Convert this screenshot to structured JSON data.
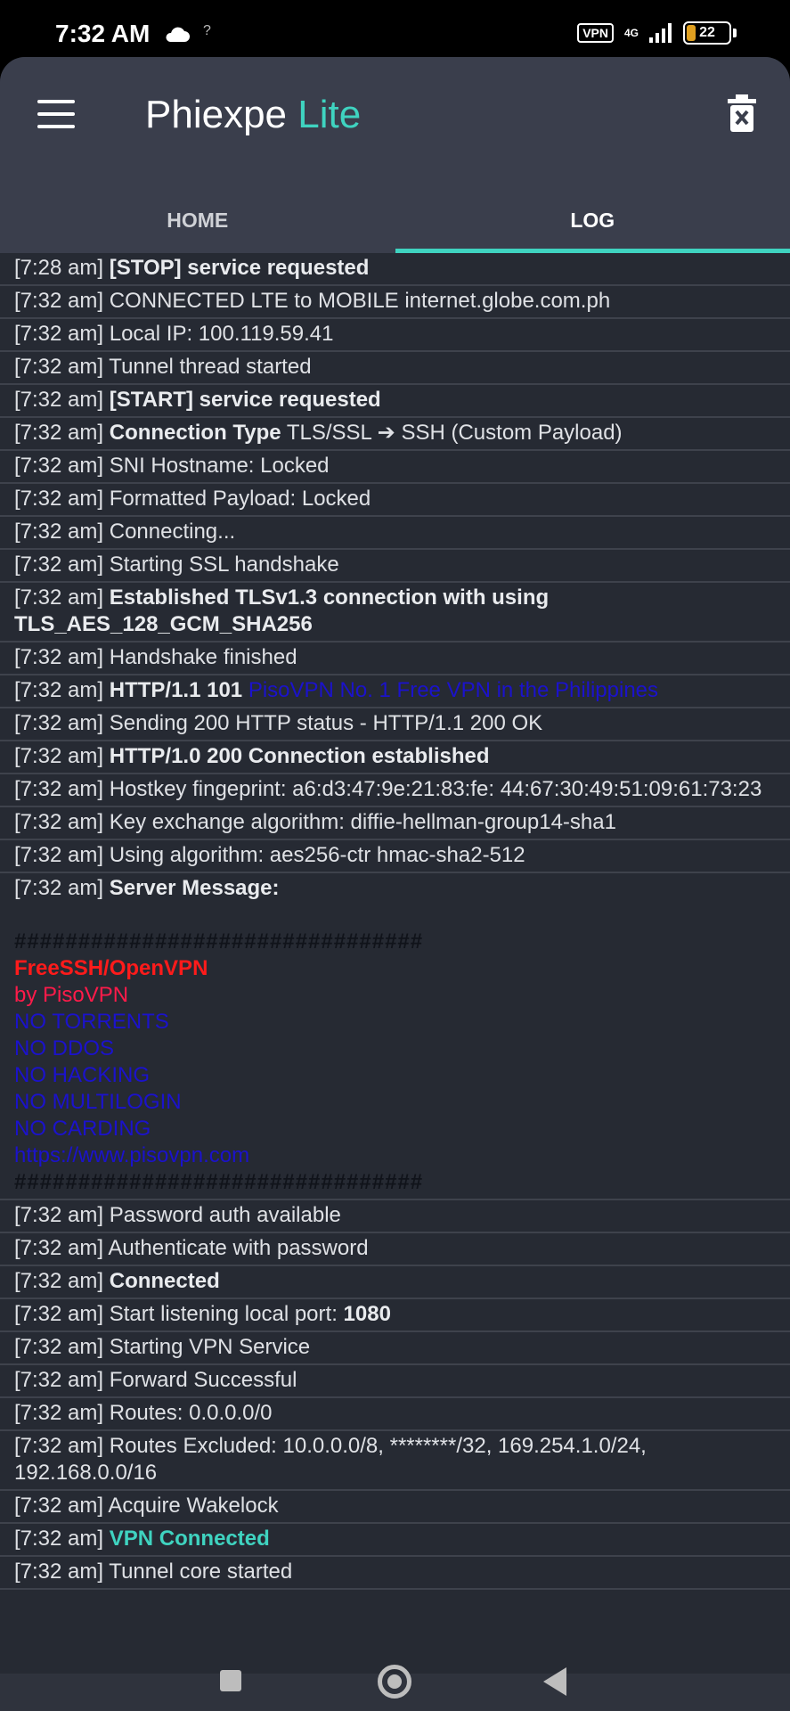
{
  "status_bar": {
    "time": "7:32 AM",
    "network_hint": "?",
    "vpn_label": "VPN",
    "network_type": "4G",
    "battery": "22"
  },
  "app": {
    "title_main": "Phiexpe",
    "title_accent": "Lite",
    "accent_color": "#3fd3c0",
    "tabs": [
      {
        "label": "HOME",
        "active": false
      },
      {
        "label": "LOG",
        "active": true
      }
    ]
  },
  "log": [
    {
      "time": "[7:28 am]",
      "bold": "[STOP] service requested",
      "text": ""
    },
    {
      "time": "[7:32 am]",
      "text": "CONNECTED LTE to MOBILE internet.globe.com.ph"
    },
    {
      "time": "[7:32 am]",
      "text": "Local IP: 100.119.59.41"
    },
    {
      "time": "[7:32 am]",
      "text": "Tunnel thread started"
    },
    {
      "time": "[7:32 am]",
      "bold": "[START] service requested",
      "text": ""
    },
    {
      "time": "[7:32 am]",
      "bold": "Connection Type",
      "text": "TLS/SSL ➔ SSH (Custom Payload)"
    },
    {
      "time": "[7:32 am]",
      "text": "SNI Hostname: Locked"
    },
    {
      "time": "[7:32 am]",
      "text": "Formatted Payload: Locked"
    },
    {
      "time": "[7:32 am]",
      "text": "Connecting..."
    },
    {
      "time": "[7:32 am]",
      "text": "Starting SSL handshake"
    },
    {
      "time": "[7:32 am]",
      "bold": "Established TLSv1.3 connection with using TLS_AES_128_GCM_SHA256",
      "text": ""
    },
    {
      "time": "[7:32 am]",
      "text": "Handshake finished"
    },
    {
      "time": "[7:32 am]",
      "bold": "HTTP/1.1 101",
      "blue": "PisoVPN No. 1 Free VPN in the Philippines",
      "text": ""
    },
    {
      "time": "[7:32 am]",
      "text": "Sending 200 HTTP status - HTTP/1.1 200 OK"
    },
    {
      "time": "[7:32 am]",
      "bold": "HTTP/1.0 200 Connection established",
      "text": ""
    },
    {
      "time": "[7:32 am]",
      "text": "Hostkey fingeprint: a6:d3:47:9e:21:83:fe: 44:67:30:49:51:09:61:73:23"
    },
    {
      "time": "[7:32 am]",
      "text": "Key exchange algorithm: diffie-hellman-group14-sha1"
    },
    {
      "time": "[7:32 am]",
      "text": "Using algorithm: aes256-ctr hmac-sha2-512"
    }
  ],
  "server_message": {
    "time": "[7:32 am]",
    "label": "Server Message:",
    "hashes": "################################",
    "line_red": "FreeSSH/OpenVPN",
    "line_pink": "by PisoVPN",
    "blue_lines": [
      "NO TORRENTS",
      "NO DDOS",
      "NO HACKING",
      "NO MULTILOGIN",
      "NO CARDING",
      "https://www.pisovpn.com"
    ]
  },
  "log2": [
    {
      "time": "[7:32 am]",
      "text": "Password auth available"
    },
    {
      "time": "[7:32 am]",
      "text": "Authenticate with password"
    },
    {
      "time": "[7:32 am]",
      "bold": "Connected",
      "text": ""
    },
    {
      "time": "[7:32 am]",
      "text": "Start listening local port:",
      "bold_after": "1080"
    },
    {
      "time": "[7:32 am]",
      "text": "Starting VPN Service"
    },
    {
      "time": "[7:32 am]",
      "text": "Forward Successful"
    },
    {
      "time": "[7:32 am]",
      "text": "Routes: 0.0.0.0/0"
    },
    {
      "time": "[7:32 am]",
      "text": "Routes Excluded: 10.0.0.0/8, ********/32, 169.254.1.0/24, 192.168.0.0/16"
    },
    {
      "time": "[7:32 am]",
      "text": "Acquire Wakelock"
    },
    {
      "time": "[7:32 am]",
      "cyan": "VPN Connected",
      "text": ""
    },
    {
      "time": "[7:32 am]",
      "text": "Tunnel core started"
    }
  ]
}
